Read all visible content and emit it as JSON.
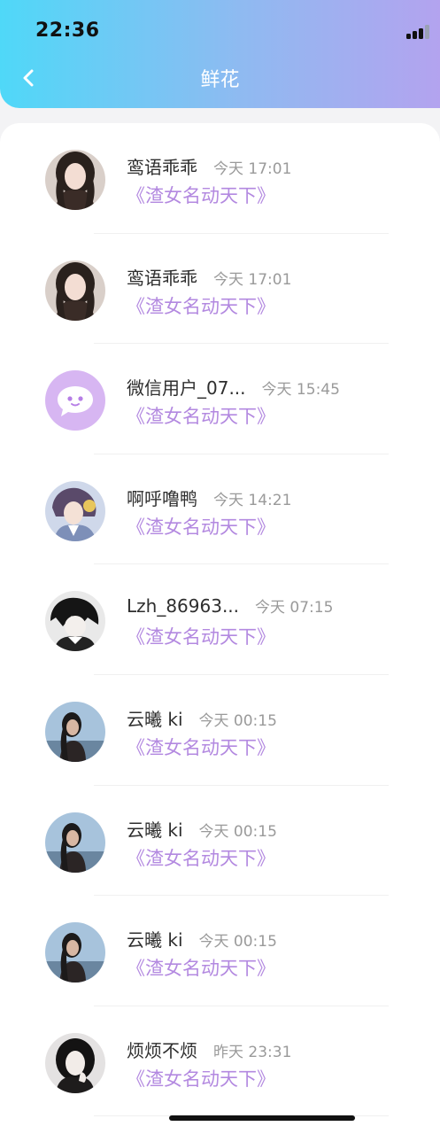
{
  "status_bar": {
    "time": "22:36"
  },
  "header": {
    "title": "鲜花",
    "back_icon": "chevron-left-icon",
    "gradient_colors": [
      "#4fd8f8",
      "#b3a3ef"
    ]
  },
  "accent_color": "#b389e0",
  "list": [
    {
      "name": "鸾语乖乖",
      "time": "今天 17:01",
      "book": "《渣女名动天下》",
      "avatar": "photo"
    },
    {
      "name": "鸾语乖乖",
      "time": "今天 17:01",
      "book": "《渣女名动天下》",
      "avatar": "photo"
    },
    {
      "name": "微信用户_07...",
      "time": "今天 15:45",
      "book": "《渣女名动天下》",
      "avatar": "default-chat-avatar-icon"
    },
    {
      "name": "啊呼噜鸭",
      "time": "今天 14:21",
      "book": "《渣女名动天下》",
      "avatar": "photo"
    },
    {
      "name": "Lzh_86963...",
      "time": "今天 07:15",
      "book": "《渣女名动天下》",
      "avatar": "photo"
    },
    {
      "name": "云曦 ki",
      "time": "今天 00:15",
      "book": "《渣女名动天下》",
      "avatar": "photo"
    },
    {
      "name": "云曦 ki",
      "time": "今天 00:15",
      "book": "《渣女名动天下》",
      "avatar": "photo"
    },
    {
      "name": "云曦 ki",
      "time": "今天 00:15",
      "book": "《渣女名动天下》",
      "avatar": "photo"
    },
    {
      "name": "烦烦不烦",
      "time": "昨天 23:31",
      "book": "《渣女名动天下》",
      "avatar": "photo"
    }
  ]
}
